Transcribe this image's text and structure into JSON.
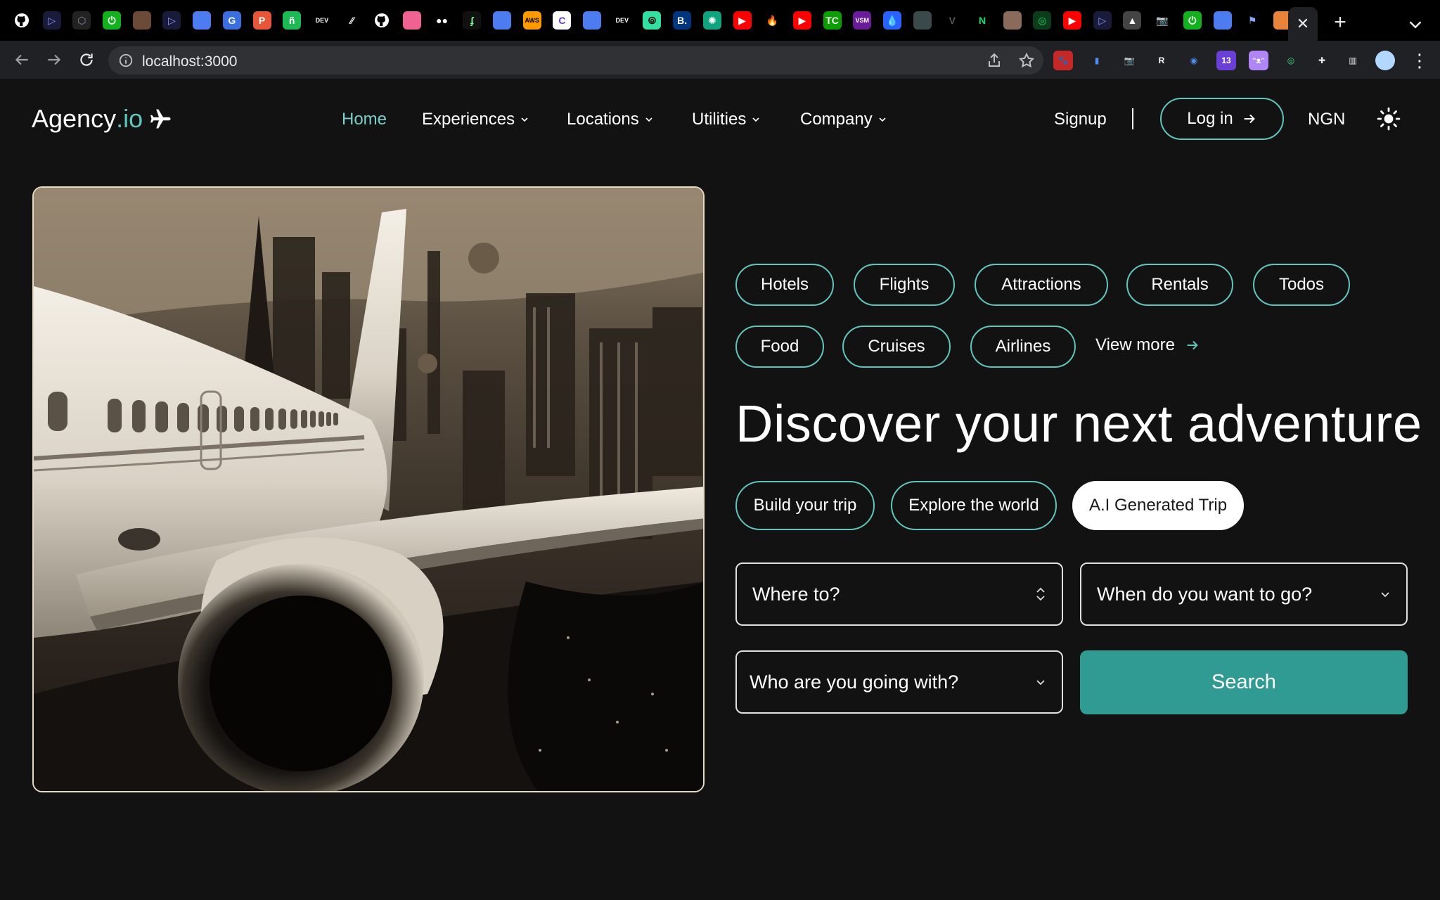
{
  "browser": {
    "tabs": [
      {
        "icon": "github-icon",
        "text": "",
        "bg": "#000000",
        "fg": "#ffffff"
      },
      {
        "icon": "play-icon",
        "text": "▷",
        "bg": "#1a1a3a",
        "fg": "#8a9cff"
      },
      {
        "icon": "hexagon-icon",
        "text": "⬡",
        "bg": "#222222",
        "fg": "#8888aa"
      },
      {
        "icon": "power-icon",
        "text": "⏻",
        "bg": "#14b11e",
        "fg": "#ffffff"
      },
      {
        "icon": "photo-icon",
        "text": "",
        "bg": "#6b4a3a",
        "fg": "#ffffff"
      },
      {
        "icon": "play-icon",
        "text": "▷",
        "bg": "#1a1a3a",
        "fg": "#8a9cff"
      },
      {
        "icon": "circle-logo-icon",
        "text": "",
        "bg": "#4c7cf0",
        "fg": "#ffffff"
      },
      {
        "icon": "google-icon",
        "text": "G",
        "bg": "#3b6fe0",
        "fg": "#ffffff"
      },
      {
        "icon": "producthunt-icon",
        "text": "P",
        "bg": "#e8563a",
        "fg": "#ffffff"
      },
      {
        "icon": "leaf-icon",
        "text": "ñ",
        "bg": "#1db954",
        "fg": "#ffffff"
      },
      {
        "icon": "dev-icon",
        "text": "DEV",
        "bg": "#000000",
        "fg": "#ffffff"
      },
      {
        "icon": "slash-icon",
        "text": "⁄⁄",
        "bg": "#000000",
        "fg": "#ffffff"
      },
      {
        "icon": "github-icon",
        "text": "",
        "bg": "#000000",
        "fg": "#ffffff"
      },
      {
        "icon": "app-icon",
        "text": "",
        "bg": "#f06292",
        "fg": "#ffffff"
      },
      {
        "icon": "medium-icon",
        "text": "●●",
        "bg": "#000000",
        "fg": "#ffffff"
      },
      {
        "icon": "script-icon",
        "text": "ʄ",
        "bg": "#111111",
        "fg": "#7cfc9a"
      },
      {
        "icon": "circle-logo-icon",
        "text": "",
        "bg": "#4c7cf0",
        "fg": "#ffffff"
      },
      {
        "icon": "aws-icon",
        "text": "AWS",
        "bg": "#ff9900",
        "fg": "#000000"
      },
      {
        "icon": "c-icon",
        "text": "C",
        "bg": "#ffffff",
        "fg": "#6b3ad6"
      },
      {
        "icon": "circle-logo-icon",
        "text": "",
        "bg": "#4c7cf0",
        "fg": "#ffffff"
      },
      {
        "icon": "dev-icon",
        "text": "DEV",
        "bg": "#000000",
        "fg": "#ffffff"
      },
      {
        "icon": "tripadvisor-icon",
        "text": "⦾",
        "bg": "#34e0a1",
        "fg": "#000000"
      },
      {
        "icon": "booking-icon",
        "text": "B.",
        "bg": "#003580",
        "fg": "#ffffff"
      },
      {
        "icon": "openai-icon",
        "text": "✺",
        "bg": "#10a37f",
        "fg": "#ffffff"
      },
      {
        "icon": "youtube-icon",
        "text": "▶",
        "bg": "#ff0000",
        "fg": "#ffffff"
      },
      {
        "icon": "firebase-icon",
        "text": "🔥",
        "bg": "#000000",
        "fg": "#ffca28"
      },
      {
        "icon": "youtube-icon",
        "text": "▶",
        "bg": "#ff0000",
        "fg": "#ffffff"
      },
      {
        "icon": "techcrunch-icon",
        "text": "TC",
        "bg": "#0a9e01",
        "fg": "#ffffff"
      },
      {
        "icon": "vsm-icon",
        "text": "VSM",
        "bg": "#6a1b9a",
        "fg": "#ffffff"
      },
      {
        "icon": "drop-icon",
        "text": "💧",
        "bg": "#2962ff",
        "fg": "#ffffff"
      },
      {
        "icon": "monitor-icon",
        "text": "",
        "bg": "#3a4a4a",
        "fg": "#ffffff"
      },
      {
        "icon": "v-icon",
        "text": "V",
        "bg": "#000000",
        "fg": "#555555"
      },
      {
        "icon": "n-icon",
        "text": "N",
        "bg": "#000000",
        "fg": "#00e676"
      },
      {
        "icon": "avatar-icon",
        "text": "",
        "bg": "#8a6a5a",
        "fg": "#ffffff"
      },
      {
        "icon": "spiral-icon",
        "text": "◎",
        "bg": "#0b3d1a",
        "fg": "#2ecc71"
      },
      {
        "icon": "youtube-icon",
        "text": "▶",
        "bg": "#ff0000",
        "fg": "#ffffff"
      },
      {
        "icon": "play-icon",
        "text": "▷",
        "bg": "#1a1a3a",
        "fg": "#8a9cff"
      },
      {
        "icon": "triangle-icon",
        "text": "▲",
        "bg": "#444444",
        "fg": "#ffffff"
      },
      {
        "icon": "camera-icon",
        "text": "📷",
        "bg": "#000000",
        "fg": "#cccccc"
      },
      {
        "icon": "power-icon",
        "text": "⏻",
        "bg": "#14b11e",
        "fg": "#ffffff"
      },
      {
        "icon": "circle-logo-icon",
        "text": "",
        "bg": "#4c7cf0",
        "fg": "#ffffff"
      },
      {
        "icon": "flag-icon",
        "text": "⚑",
        "bg": "#000000",
        "fg": "#8aa8ff"
      },
      {
        "icon": "fox-icon",
        "text": "",
        "bg": "#e8833a",
        "fg": "#ffffff"
      }
    ],
    "address": "localhost:3000",
    "extensions": [
      {
        "icon": "paw-icon",
        "text": "🐾",
        "bg": "#c62828",
        "fg": "#ffffff"
      },
      {
        "icon": "document-icon",
        "text": "▮",
        "bg": "#202124",
        "fg": "#4f8df5"
      },
      {
        "icon": "camera-icon",
        "text": "📷",
        "bg": "#202124",
        "fg": "#cccccc"
      },
      {
        "icon": "reader-icon",
        "text": "R",
        "bg": "#202124",
        "fg": "#ffffff"
      },
      {
        "icon": "globe-icon",
        "text": "◉",
        "bg": "#202124",
        "fg": "#4f8df5"
      },
      {
        "icon": "badge-ext-icon",
        "text": "13",
        "bg": "#6a3fd6",
        "fg": "#ffffff"
      },
      {
        "icon": "cat-icon",
        "text": "ᵔᴥᵔ",
        "bg": "#b085f5",
        "fg": "#ffffff"
      },
      {
        "icon": "target-icon",
        "text": "◎",
        "bg": "#202124",
        "fg": "#3ddc84"
      },
      {
        "icon": "puzzle-icon",
        "text": "✚",
        "bg": "#202124",
        "fg": "#e8eaed"
      },
      {
        "icon": "sidepanel-icon",
        "text": "▥",
        "bg": "#202124",
        "fg": "#e8eaed"
      },
      {
        "icon": "profile-avatar-icon",
        "text": "",
        "bg": "#b3d8ff",
        "fg": "#333333"
      }
    ]
  },
  "site": {
    "logo_main": "Agency",
    "logo_suffix": ".io",
    "nav": {
      "home": "Home",
      "experiences": "Experiences",
      "locations": "Locations",
      "utilities": "Utilities",
      "company": "Company"
    },
    "signup": "Signup",
    "login": "Log in",
    "currency": "NGN"
  },
  "hero": {
    "categories": [
      "Hotels",
      "Flights",
      "Attractions",
      "Rentals",
      "Todos",
      "Food",
      "Cruises",
      "Airlines"
    ],
    "view_more": "View more",
    "headline": "Discover your next adventure",
    "modes": [
      "Build your trip",
      "Explore the world",
      "A.I Generated Trip"
    ],
    "selected_mode": "A.I Generated Trip",
    "form": {
      "destination": "Where to?",
      "date": "When do you want to go?",
      "travellers": "Who are you going with?",
      "search": "Search"
    }
  },
  "colors": {
    "accent": "#5fc5bd",
    "nav_active": "#78d0c8",
    "search_button": "#2f9b93",
    "background": "#121212"
  }
}
